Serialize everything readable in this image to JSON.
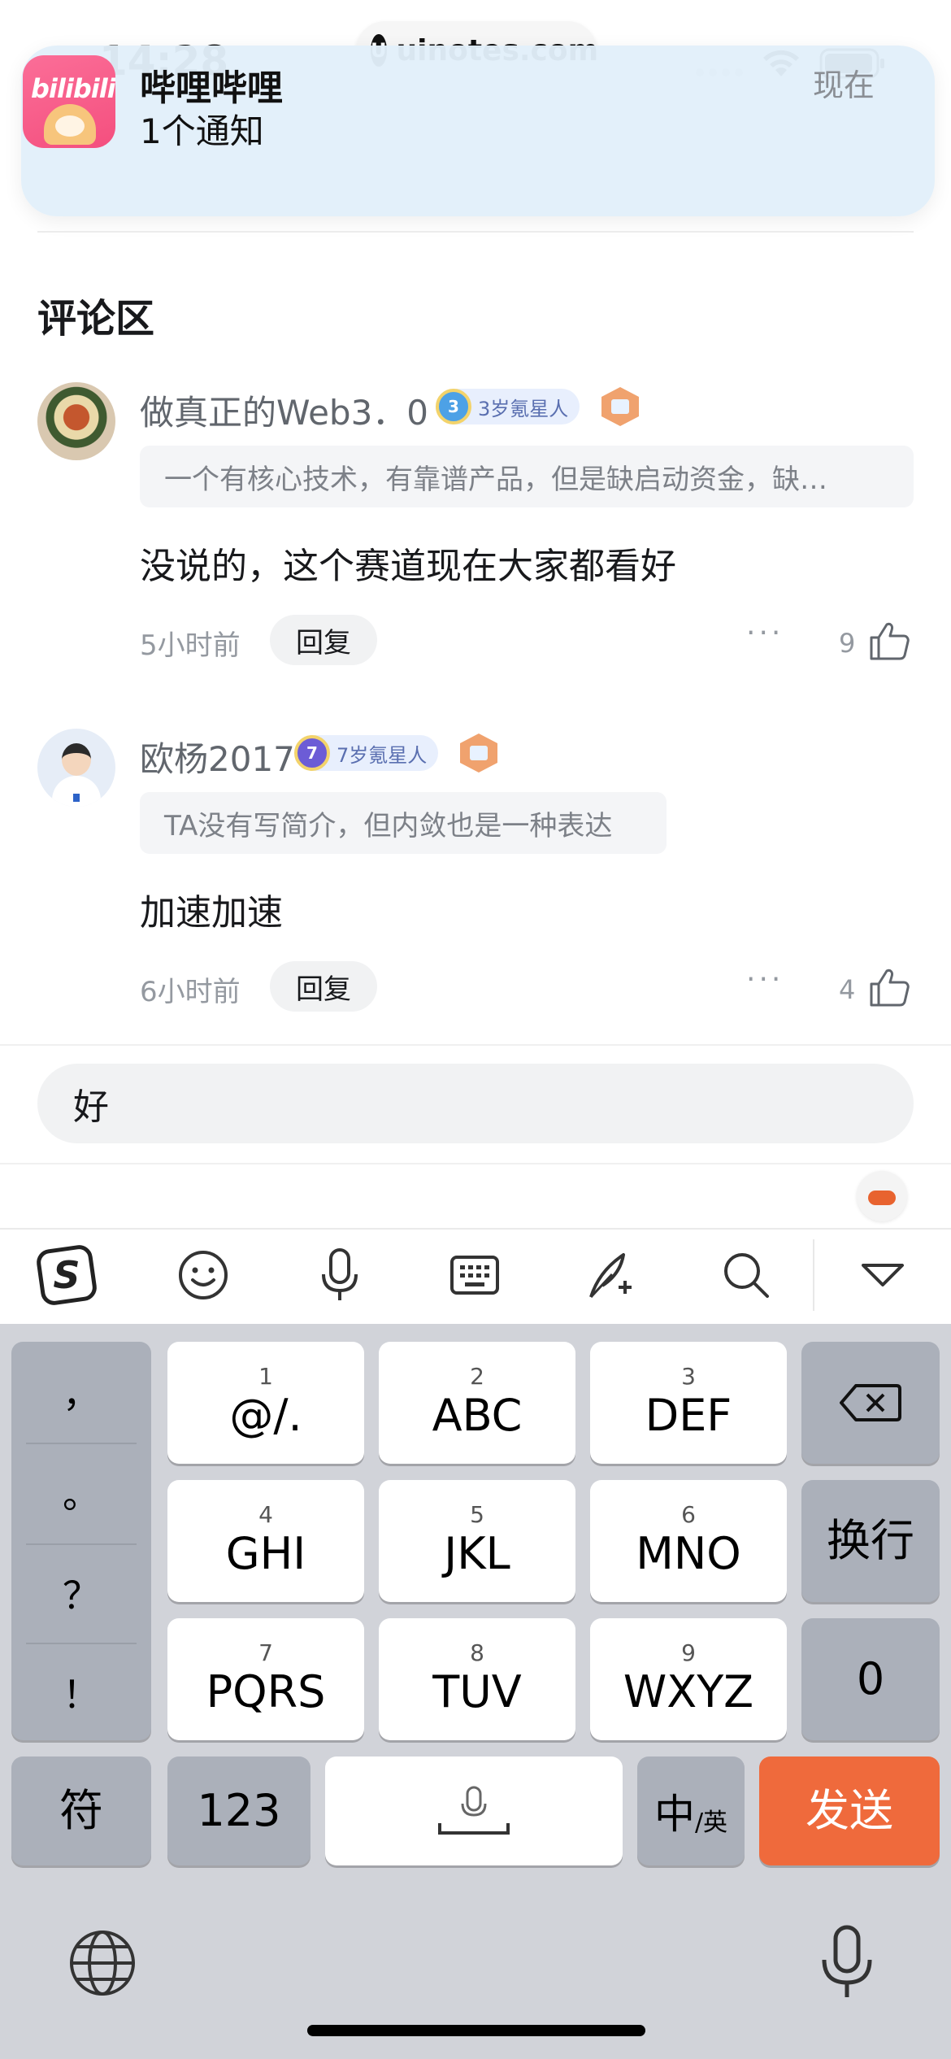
{
  "status_bar": {
    "time": "14:28",
    "watermark": "uinotes.com",
    "watermark_logo": "U"
  },
  "notification": {
    "app_name": "哔哩哔哩",
    "message": "1个通知",
    "time": "现在",
    "icon_text": "bilibili"
  },
  "section": {
    "title": "评论区"
  },
  "comments": [
    {
      "username": "做真正的Web3．0",
      "medal_level": "3",
      "medal_label": "3岁氪星人",
      "bio": "一个有核心技术，有靠谱产品，但是缺启动资金，缺…",
      "content": "没说的，这个赛道现在大家都看好",
      "time": "5小时前",
      "reply_label": "回复",
      "more_label": "···",
      "likes": "9"
    },
    {
      "username": "欧杨2017",
      "medal_level": "7",
      "medal_label": "7岁氪星人",
      "bio": "TA没有写简介，但内敛也是一种表达",
      "content": "加速加速",
      "time": "6小时前",
      "reply_label": "回复",
      "more_label": "···",
      "likes": "4"
    }
  ],
  "reply_input": {
    "value": "好"
  },
  "keyboard": {
    "punctuation": [
      "，",
      "。",
      "？",
      "！"
    ],
    "keys": [
      {
        "num": "1",
        "label": "@/."
      },
      {
        "num": "2",
        "label": "ABC"
      },
      {
        "num": "3",
        "label": "DEF"
      },
      {
        "num": "4",
        "label": "GHI"
      },
      {
        "num": "5",
        "label": "JKL"
      },
      {
        "num": "6",
        "label": "MNO"
      },
      {
        "num": "7",
        "label": "PQRS"
      },
      {
        "num": "8",
        "label": "TUV"
      },
      {
        "num": "9",
        "label": "WXYZ"
      }
    ],
    "enter_label": "换行",
    "zero_label": "0",
    "symbols_label": "符",
    "numbers_label": "123",
    "lang_main": "中",
    "lang_sub": "/英",
    "send_label": "发送",
    "send_color": "#ef6a3c"
  },
  "toolbar_icons": [
    "sogou-logo-icon",
    "emoji-icon",
    "microphone-icon",
    "keyboard-icon",
    "handwriting-icon",
    "search-icon",
    "collapse-icon"
  ],
  "colors": {
    "accent_pink": "#fb7299",
    "send_orange": "#ef6a3c",
    "keyboard_bg": "#d1d3d9"
  }
}
